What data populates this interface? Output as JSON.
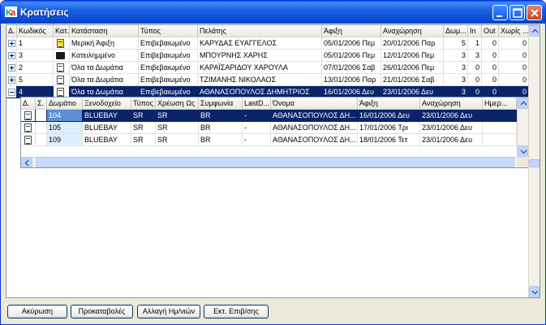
{
  "window": {
    "title": "Κρατήσεις"
  },
  "main_grid": {
    "columns": [
      "Δ.",
      "Κωδικός",
      "Κατ.",
      "Κατάσταση",
      "Τύπος",
      "Πελάτης",
      "Άφιξη",
      "Αναχώρηση",
      "Δωμ...",
      "In",
      "Out",
      "Χωρίς ..."
    ],
    "rows": [
      {
        "code": "1",
        "icon": "yellow-doc-icon",
        "status": "Μερική Άφιξη",
        "type": "Επιβεβαιωμένο",
        "customer": "ΚΑΡΥΔΑΣ ΕΥΑΓΓΕΛΟΣ",
        "arrival": "05/01/2006 Πεμ",
        "departure": "20/01/2006 Παρ",
        "rooms": "5",
        "in": "1",
        "out": "0",
        "without": "0",
        "expander": "+"
      },
      {
        "code": "3",
        "icon": "folder-icon",
        "status": "Κατειλημμένο",
        "type": "Επιβεβαιωμένο",
        "customer": "ΜΠΟΥΡΝΗΣ ΧΑΡΗΣ",
        "arrival": "05/01/2006 Πεμ",
        "departure": "12/01/2006 Πεμ",
        "rooms": "3",
        "in": "3",
        "out": "0",
        "without": "0",
        "expander": "+"
      },
      {
        "code": "2",
        "icon": "doc-icon",
        "status": "Όλα τα Δωμάτια",
        "type": "Επιβεβαιωμένο",
        "customer": "ΚΑΡΑΪΣΑΡΙΔΟΥ ΧΑΡΟΥΛΑ",
        "arrival": "07/01/2006 Σαβ",
        "departure": "26/01/2006 Πεμ",
        "rooms": "3",
        "in": "0",
        "out": "0",
        "without": "0",
        "expander": "+"
      },
      {
        "code": "5",
        "icon": "doc-icon",
        "status": "Όλα τα Δωμάτια",
        "type": "Επιβεβαιωμένο",
        "customer": "ΤΖΙΜΑΝΗΣ ΝΙΚΟΛΑΟΣ",
        "arrival": "13/01/2006 Παρ",
        "departure": "21/01/2006 Σαβ",
        "rooms": "3",
        "in": "0",
        "out": "0",
        "without": "0",
        "expander": "+"
      },
      {
        "code": "4",
        "icon": "doc-icon",
        "status": "Όλα τα Δωμάτια",
        "type": "Επιβεβαιωμένο",
        "customer": "ΑΘΑΝΑΣΟΠΟΥΛΟΣ ΔΗΜΗΤΡΙΟΣ",
        "arrival": "16/01/2006 Δευ",
        "departure": "23/01/2006 Δευ",
        "rooms": "3",
        "in": "0",
        "out": "0",
        "without": "0",
        "expander": "-"
      }
    ]
  },
  "sub_grid": {
    "columns": [
      "Δ.",
      "Σ.",
      "Δωμάτιο",
      "Ξενοδοχείο",
      "Τύπος",
      "Χρέωση Ως",
      "Συμφωνία",
      "LastD...",
      "Όνομα",
      "Άφιξη",
      "Αναχώρηση",
      "Ημερ..."
    ],
    "rows": [
      {
        "room": "104",
        "hotel": "BLUEBAY",
        "type": "SR",
        "charge": "SR",
        "agreement": "BR",
        "last": "-",
        "name": "ΑΘΑΝΑΣΟΠΟΥΛΟΣ ΔΗ...",
        "arrival": "16/01/2006 Δευ",
        "departure": "23/01/2006 Δευ"
      },
      {
        "room": "105",
        "hotel": "BLUEBAY",
        "type": "SR",
        "charge": "SR",
        "agreement": "BR",
        "last": "-",
        "name": "ΑΘΑΝΑΣΟΠΟΥΛΟΣ ΔΗ...",
        "arrival": "17/01/2006 Τρι",
        "departure": "23/01/2006 Δευ"
      },
      {
        "room": "109",
        "hotel": "BLUEBAY",
        "type": "SR",
        "charge": "SR",
        "agreement": "BR",
        "last": "-",
        "name": "ΑΘΑΝΑΣΟΠΟΥΛΟΣ ΔΗ...",
        "arrival": "18/01/2006 Τετ",
        "departure": "23/01/2006 Δευ"
      }
    ]
  },
  "buttons": {
    "cancel": "Ακύρωση",
    "defaults": "Προκαταβολές",
    "change_dates": "Αλλαγή Ημ/νιών",
    "print": "Εκτ. Επιβ/σης"
  },
  "colors": {
    "title_bar": "#0a4fd6",
    "selection": "#0a246a"
  }
}
